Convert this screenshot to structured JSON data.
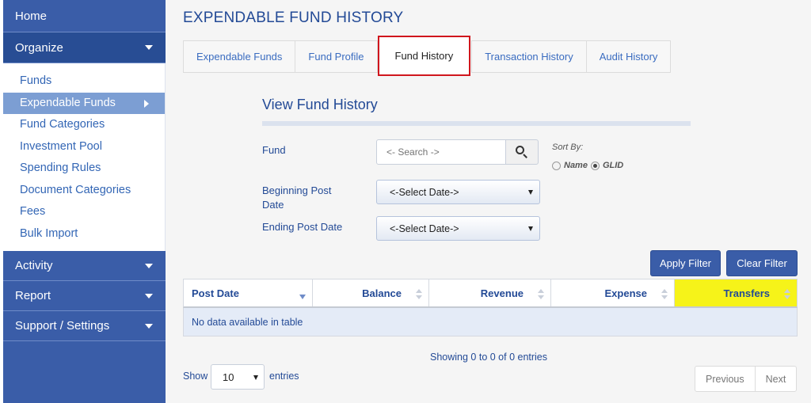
{
  "sidebar": {
    "home": "Home",
    "organize": {
      "label": "Organize",
      "items": [
        "Funds",
        "Expendable Funds",
        "Fund Categories",
        "Investment Pool",
        "Spending Rules",
        "Document Categories",
        "Fees",
        "Bulk Import"
      ]
    },
    "activity": "Activity",
    "report": "Report",
    "support": "Support / Settings"
  },
  "page": {
    "title": "EXPENDABLE FUND HISTORY"
  },
  "tabs": [
    "Expendable Funds",
    "Fund Profile",
    "Fund History",
    "Transaction History",
    "Audit History"
  ],
  "form": {
    "title": "View Fund History",
    "fund_label": "Fund",
    "search_placeholder": "<- Search ->",
    "sort_by_label": "Sort By:",
    "sort_name": "Name",
    "sort_glid": "GLID",
    "begin_label_1": "Beginning Post",
    "begin_label_2": "Date",
    "begin_select": "<-Select Date->",
    "end_label": "Ending Post Date",
    "end_select": "<-Select Date->",
    "apply": "Apply Filter",
    "clear": "Clear Filter"
  },
  "table": {
    "columns": [
      "Post Date",
      "Balance",
      "Revenue",
      "Expense",
      "Transfers"
    ],
    "empty": "No data available in table",
    "info": "Showing 0 to 0 of 0 entries",
    "show": "Show",
    "length": "10",
    "entries": "entries",
    "previous": "Previous",
    "next": "Next"
  },
  "colors": {
    "sidebar": "#3a5da8",
    "accent": "#234a96",
    "highlight": "#f6f319",
    "tab_outline": "#d0161d"
  }
}
